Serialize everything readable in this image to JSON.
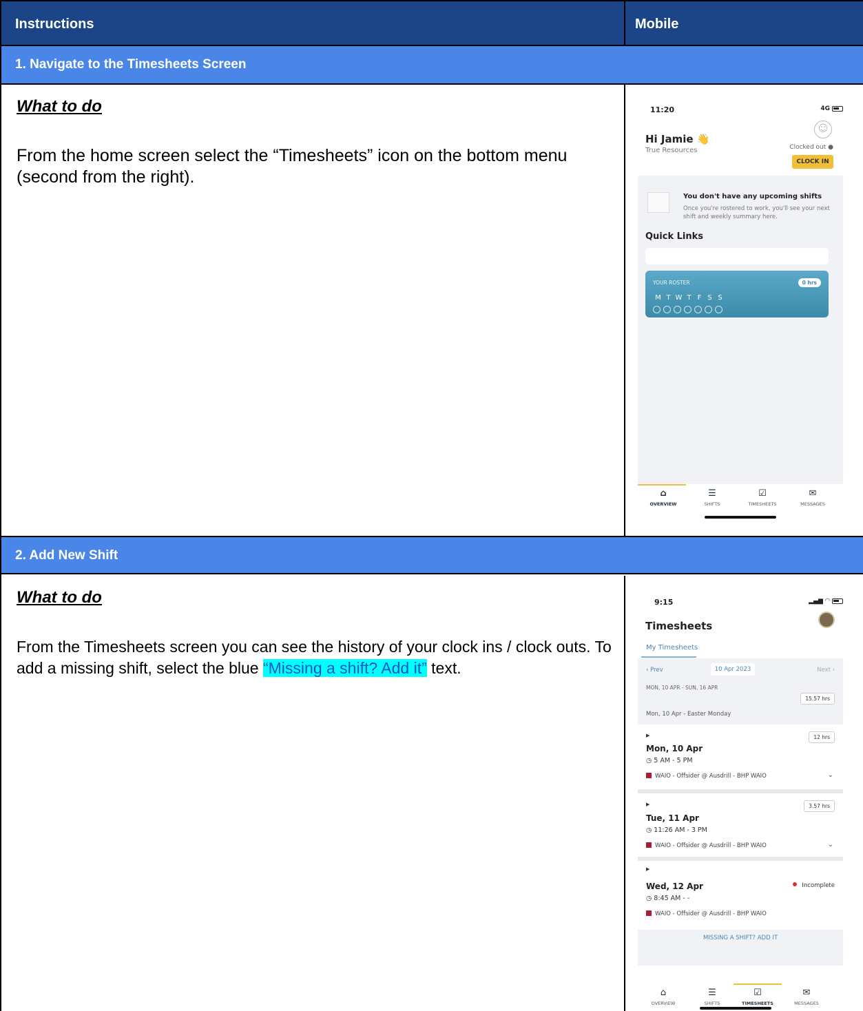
{
  "header": {
    "col1": "Instructions",
    "col2": "Mobile"
  },
  "step1": {
    "title": "1. Navigate to the Timesheets Screen",
    "what_to_do": "What to do",
    "text": "From the home screen select the “Timesheets” icon on the bottom menu (second from the right).",
    "phone": {
      "time": "11:20",
      "signal": "4G",
      "greeting": "Hi Jamie 👋",
      "company": "True Resources",
      "clocked_status": "Clocked out ●",
      "clock_in": "CLOCK IN",
      "no_shifts_title": "You don't have any upcoming shifts",
      "no_shifts_text": "Once you're rostered to work, you'll see your next shift and weekly summary here.",
      "quick_links": "Quick Links",
      "roster_label": "YOUR ROSTER",
      "roster_hours": "0 hrs",
      "days": [
        "M",
        "T",
        "W",
        "T",
        "F",
        "S",
        "S"
      ],
      "nav": [
        "OVERVIEW",
        "SHIFTS",
        "TIMESHEETS",
        "MESSAGES"
      ]
    }
  },
  "step2": {
    "title": "2. Add New Shift",
    "what_to_do": "What to do",
    "text_before": "From the Timesheets screen you can see the history of your clock ins / clock outs. To add a missing shift, select the blue ",
    "text_highlight": "“Missing a shift? Add it”",
    "text_after": " text.",
    "phone": {
      "time": "9:15",
      "title": "Timesheets",
      "tab": "My Timesheets",
      "prev": "‹ Prev",
      "date": "10 Apr 2023",
      "next": "Next ›",
      "week": "MON, 10 APR - SUN, 16 APR",
      "week_hours": "15.57 hrs",
      "holiday": "Mon, 10 Apr - Easter Monday",
      "shifts": [
        {
          "day": "Mon, 10 Apr",
          "time": "◷ 5 AM - 5 PM",
          "job": "WAIO - Offsider @ Ausdrill - BHP WAIO",
          "hours": "12 hrs"
        },
        {
          "day": "Tue, 11 Apr",
          "time": "◷ 11:26 AM - 3 PM",
          "job": "WAIO - Offsider @ Ausdrill - BHP WAIO",
          "hours": "3.57 hrs"
        },
        {
          "day": "Wed, 12 Apr",
          "time": "◷ 8:45 AM - -",
          "job": "WAIO - Offsider @ Ausdrill - BHP WAIO",
          "status": "Incomplete"
        }
      ],
      "missing_shift": "MISSING A SHIFT? ADD IT",
      "nav": [
        "OVERVIEW",
        "SHIFTS",
        "TIMESHEETS",
        "MESSAGES"
      ]
    }
  }
}
